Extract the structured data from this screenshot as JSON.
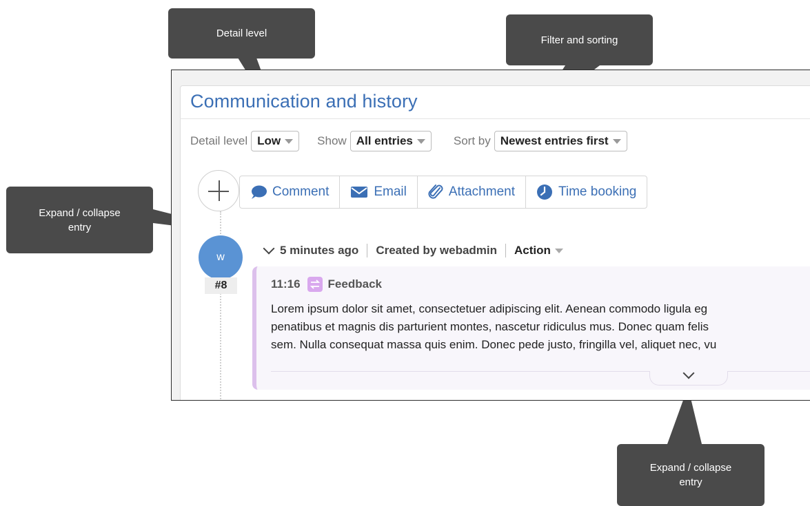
{
  "panel": {
    "title": "Communication and history"
  },
  "filters": {
    "detail_label": "Detail level",
    "detail_value": "Low",
    "show_label": "Show",
    "show_value": "All entries",
    "sort_label": "Sort by",
    "sort_value": "Newest entries first"
  },
  "actions": [
    {
      "label": "Comment",
      "icon": "comment-icon"
    },
    {
      "label": "Email",
      "icon": "email-icon"
    },
    {
      "label": "Attachment",
      "icon": "paperclip-icon"
    },
    {
      "label": "Time booking",
      "icon": "clock-icon"
    }
  ],
  "entry": {
    "avatar_letter": "w",
    "number": "#8",
    "relative_time": "5 minutes ago",
    "created_by": "Created by webadmin",
    "action_label": "Action",
    "time": "11:16",
    "type": "Feedback",
    "body_lines": [
      "Lorem ipsum dolor sit amet, consectetuer adipiscing elit. Aenean commodo ligula eg",
      "penatibus et magnis dis parturient montes, nascetur ridiculus mus. Donec quam felis",
      "sem. Nulla consequat massa quis enim. Donec pede justo, fringilla vel, aliquet nec, vu"
    ]
  },
  "callouts": {
    "detail": "Detail level",
    "filter": "Filter and sorting",
    "expand_left": "Expand / collapse entry",
    "expand_bottom": "Expand / collapse entry"
  },
  "colors": {
    "accent": "#3b6fb5",
    "avatar": "#5a93d4",
    "feedback": "#d9a8ee",
    "callout": "#4a4a4a"
  }
}
